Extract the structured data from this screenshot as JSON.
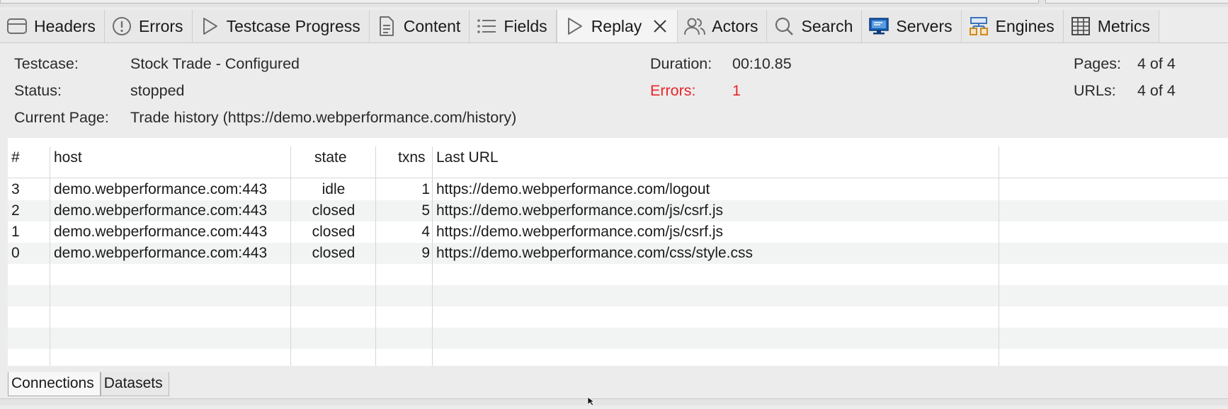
{
  "tabs": [
    {
      "name": "tab-headers",
      "label": "Headers",
      "icon": "headers-icon"
    },
    {
      "name": "tab-errors",
      "label": "Errors",
      "icon": "error-icon"
    },
    {
      "name": "tab-testcase-progress",
      "label": "Testcase Progress",
      "icon": "play-icon"
    },
    {
      "name": "tab-content",
      "label": "Content",
      "icon": "document-icon"
    },
    {
      "name": "tab-fields",
      "label": "Fields",
      "icon": "list-icon"
    },
    {
      "name": "tab-replay",
      "label": "Replay",
      "icon": "play-icon",
      "active": true
    },
    {
      "name": "tab-actors",
      "label": "Actors",
      "icon": "users-icon"
    },
    {
      "name": "tab-search",
      "label": "Search",
      "icon": "search-icon"
    },
    {
      "name": "tab-servers",
      "label": "Servers",
      "icon": "monitor-icon"
    },
    {
      "name": "tab-engines",
      "label": "Engines",
      "icon": "engines-icon"
    },
    {
      "name": "tab-metrics",
      "label": "Metrics",
      "icon": "metrics-icon"
    }
  ],
  "info": {
    "testcase_label": "Testcase:",
    "testcase_value": "Stock Trade - Configured",
    "status_label": "Status:",
    "status_value": "stopped",
    "current_page_label": "Current Page:",
    "current_page_value": "Trade history (https://demo.webperformance.com/history)",
    "duration_label": "Duration:",
    "duration_value": "00:10.85",
    "errors_label": "Errors:",
    "errors_value": "1",
    "pages_label": "Pages:",
    "pages_value": "4 of 4",
    "urls_label": "URLs:",
    "urls_value": "4 of 4"
  },
  "table": {
    "columns": [
      "#",
      "host",
      "state",
      "txns",
      "Last URL"
    ],
    "rows": [
      {
        "num": "3",
        "host": "demo.webperformance.com:443",
        "state": "idle",
        "txns": "1",
        "url": "https://demo.webperformance.com/logout"
      },
      {
        "num": "2",
        "host": "demo.webperformance.com:443",
        "state": "closed",
        "txns": "5",
        "url": "https://demo.webperformance.com/js/csrf.js"
      },
      {
        "num": "1",
        "host": "demo.webperformance.com:443",
        "state": "closed",
        "txns": "4",
        "url": "https://demo.webperformance.com/js/csrf.js"
      },
      {
        "num": "0",
        "host": "demo.webperformance.com:443",
        "state": "closed",
        "txns": "9",
        "url": "https://demo.webperformance.com/css/style.css"
      }
    ]
  },
  "bottom_tabs": [
    {
      "label": "Connections",
      "active": true
    },
    {
      "label": "Datasets",
      "active": false
    }
  ],
  "colors": {
    "error": "#e8262b",
    "row_alt": "#f2f4f3",
    "server_icon": "#1a5fb4"
  }
}
